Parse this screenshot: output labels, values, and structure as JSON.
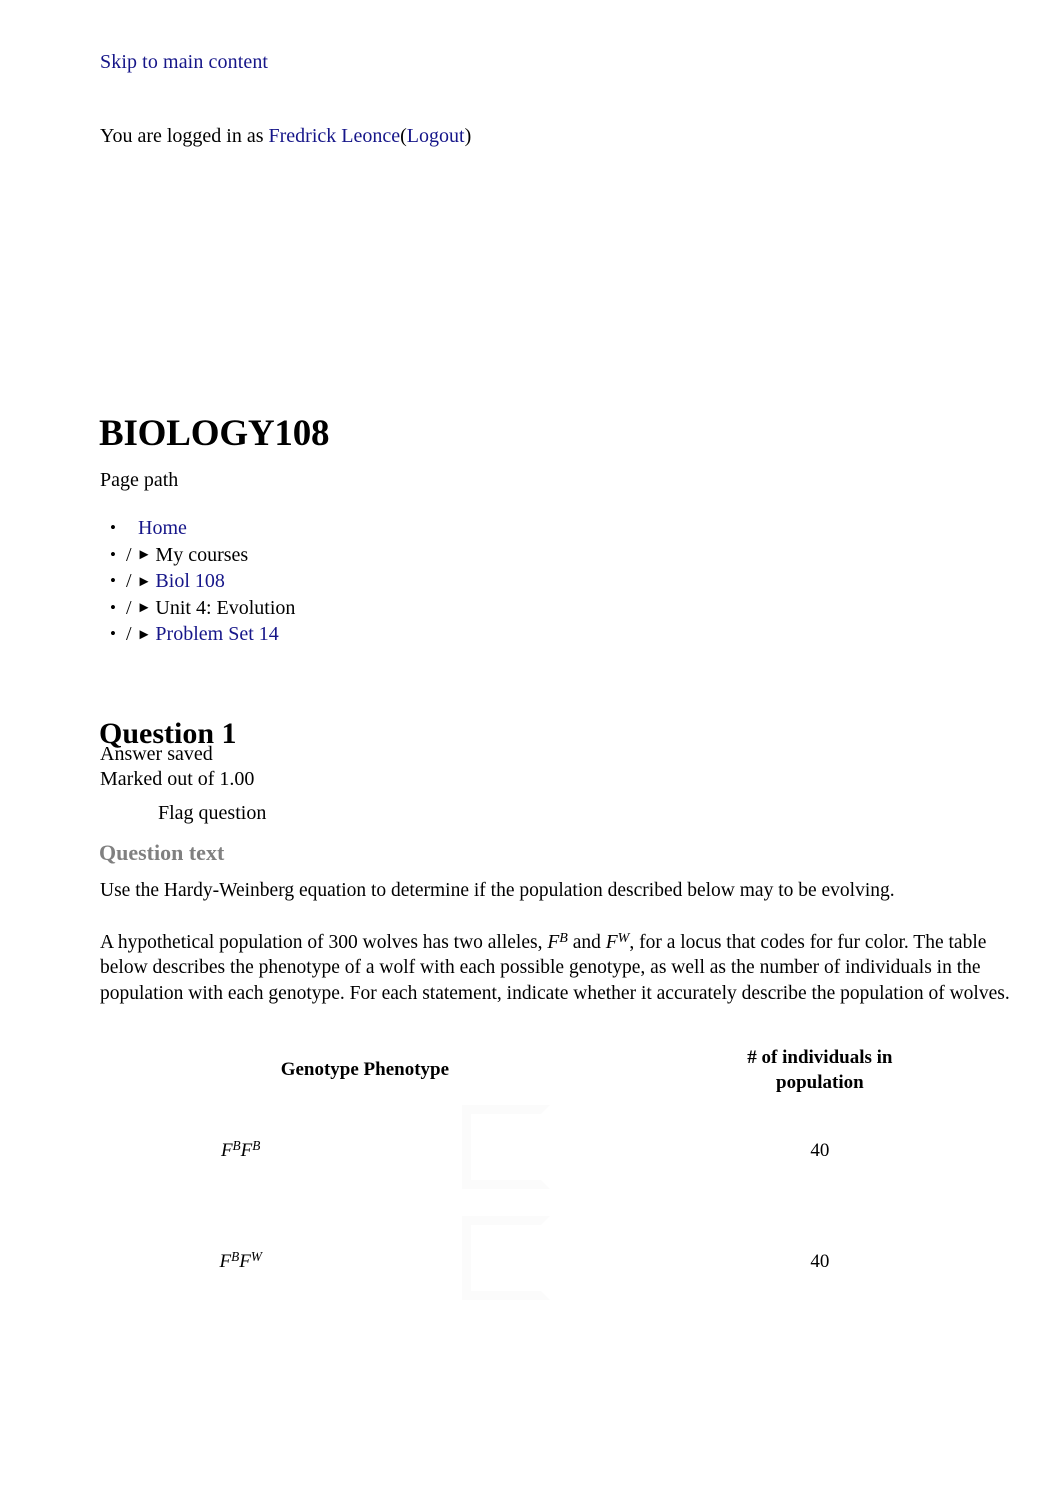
{
  "header": {
    "skip_link": "Skip to main content",
    "logged_in_prefix": "You are logged in as ",
    "user_name": "Fredrick Leonce",
    "paren_open": "(",
    "logout_label": "Logout",
    "paren_close": ")"
  },
  "site": {
    "title": "BIOLOGY108",
    "page_path_label": "Page path"
  },
  "breadcrumb": {
    "items": [
      {
        "separator": "",
        "arrow": "",
        "label": "Home",
        "is_link": true
      },
      {
        "separator": "/",
        "arrow": "►",
        "label": "My courses",
        "is_link": false
      },
      {
        "separator": "/",
        "arrow": "►",
        "label": "Biol 108",
        "is_link": true
      },
      {
        "separator": "/",
        "arrow": "►",
        "label": "Unit 4: Evolution",
        "is_link": false
      },
      {
        "separator": "/",
        "arrow": "►",
        "label": "Problem Set 14",
        "is_link": true
      }
    ],
    "bullet": "•"
  },
  "question": {
    "title": "Question 1",
    "status": "Answer saved",
    "marks": "Marked out of 1.00",
    "flag_label": "Flag question",
    "question_text_label": "Question text",
    "paragraph_1": "Use the Hardy-Weinberg equation to determine if the population described below may to be evolving.",
    "paragraph_2_part1": "A hypothetical population of 300 wolves has two alleles, ",
    "allele_b": {
      "base": "F",
      "sup": "B"
    },
    "paragraph_2_part2": " and ",
    "allele_w": {
      "base": "F",
      "sup": "W"
    },
    "paragraph_2_part3": ", for a locus that codes for fur color. The table below describes the phenotype of a wolf with each possible genotype, as well as the number of individuals in the population with each genotype. For each statement, indicate whether it accurately describe the population of wolves."
  },
  "table": {
    "headers": {
      "genotype_phenotype": "Genotype Phenotype",
      "count_line1": "# of individuals in",
      "count_line2": "population"
    },
    "rows": [
      {
        "genotype_base_1": "F",
        "genotype_sup_1": "B",
        "genotype_base_2": "F",
        "genotype_sup_2": "B",
        "phenotype_image": "broken-image-placeholder",
        "count": "40"
      },
      {
        "genotype_base_1": "F",
        "genotype_sup_1": "B",
        "genotype_base_2": "F",
        "genotype_sup_2": "W",
        "phenotype_image": "broken-image-placeholder",
        "count": "40"
      }
    ]
  },
  "colors": {
    "link": "#161689",
    "muted_heading": "#808080",
    "text": "#000000",
    "background": "#ffffff"
  }
}
